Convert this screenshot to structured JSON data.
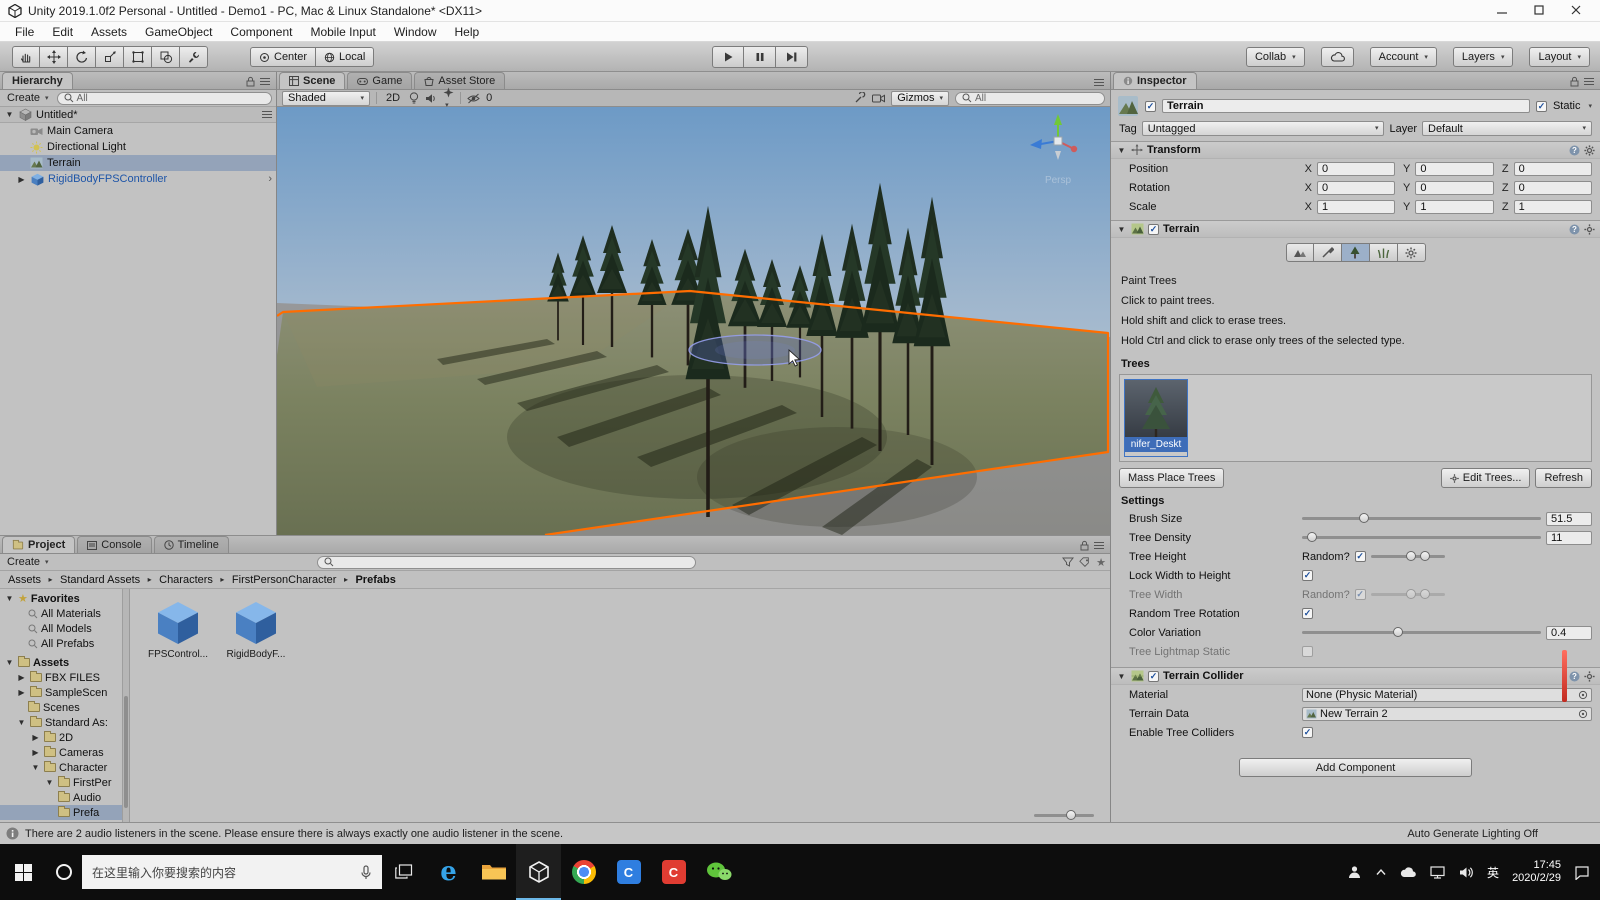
{
  "window": {
    "title": "Unity 2019.1.0f2 Personal - Untitled - Demo1 - PC, Mac & Linux Standalone* <DX11>"
  },
  "menu": {
    "items": [
      "File",
      "Edit",
      "Assets",
      "GameObject",
      "Component",
      "Mobile Input",
      "Window",
      "Help"
    ]
  },
  "toolbar": {
    "pivot_label": "Center",
    "space_label": "Local",
    "collab_label": "Collab",
    "account_label": "Account",
    "layers_label": "Layers",
    "layout_label": "Layout"
  },
  "hierarchy": {
    "tab_label": "Hierarchy",
    "create_label": "Create",
    "search_text": "All",
    "scene_row": "Untitled*",
    "items": [
      {
        "label": "Main Camera"
      },
      {
        "label": "Directional Light"
      },
      {
        "label": "Terrain"
      },
      {
        "label": "RigidBodyFPSController"
      }
    ]
  },
  "scene": {
    "tab_scene": "Scene",
    "tab_game": "Game",
    "tab_asset_store": "Asset Store",
    "shading_mode": "Shaded",
    "toggle_2d": "2D",
    "hidden_count": "0",
    "gizmos_label": "Gizmos",
    "search_text": "All",
    "gizmo_caption": "Persp"
  },
  "inspector": {
    "tab_label": "Inspector",
    "object_name": "Terrain",
    "static_label": "Static",
    "tag_label": "Tag",
    "tag_value": "Untagged",
    "layer_label": "Layer",
    "layer_value": "Default",
    "transform": {
      "title": "Transform",
      "axis_x": "X",
      "axis_y": "Y",
      "axis_z": "Z",
      "rows": [
        {
          "label": "Position",
          "x": "0",
          "y": "0",
          "z": "0"
        },
        {
          "label": "Rotation",
          "x": "0",
          "y": "0",
          "z": "0"
        },
        {
          "label": "Scale",
          "x": "1",
          "y": "1",
          "z": "1"
        }
      ]
    },
    "terrain": {
      "title": "Terrain",
      "paint_title": "Paint Trees",
      "help_1": "Click to paint trees.",
      "help_2": "Hold shift and click to erase trees.",
      "help_3": "Hold Ctrl and click to erase only trees of the selected type.",
      "trees_label": "Trees",
      "tree_thumb_label": "nifer_Deskt",
      "mass_place_label": "Mass Place Trees",
      "edit_trees_label": "Edit Trees...",
      "refresh_label": "Refresh",
      "settings_label": "Settings",
      "brush_size_label": "Brush Size",
      "brush_size_value": "51.5",
      "tree_density_label": "Tree Density",
      "tree_density_value": "11",
      "tree_height_label": "Tree Height",
      "random_label": "Random?",
      "lock_width_label": "Lock Width to Height",
      "tree_width_label": "Tree Width",
      "random_rotation_label": "Random Tree Rotation",
      "color_variation_label": "Color Variation",
      "color_variation_value": "0.4",
      "lightmap_label": "Tree Lightmap Static"
    },
    "collider": {
      "title": "Terrain Collider",
      "material_label": "Material",
      "material_value": "None (Physic Material)",
      "terrain_data_label": "Terrain Data",
      "terrain_data_value": "New Terrain 2",
      "tree_colliders_label": "Enable Tree Colliders"
    },
    "add_component_label": "Add Component"
  },
  "project": {
    "tab_project": "Project",
    "tab_console": "Console",
    "tab_timeline": "Timeline",
    "create_label": "Create",
    "breadcrumb": [
      "Assets",
      "Standard Assets",
      "Characters",
      "FirstPersonCharacter",
      "Prefabs"
    ],
    "folders": [
      {
        "label": "Favorites"
      },
      {
        "label": "All Materials"
      },
      {
        "label": "All Models"
      },
      {
        "label": "All Prefabs"
      },
      {
        "label": "Assets"
      },
      {
        "label": "FBX FILES"
      },
      {
        "label": "SampleScen"
      },
      {
        "label": "Scenes"
      },
      {
        "label": "Standard As:"
      },
      {
        "label": "2D"
      },
      {
        "label": "Cameras"
      },
      {
        "label": "Character"
      },
      {
        "label": "FirstPer"
      },
      {
        "label": "Audio"
      },
      {
        "label": "Prefa"
      }
    ],
    "files": [
      {
        "label": "FPSControl..."
      },
      {
        "label": "RigidBodyF..."
      }
    ]
  },
  "status_bar": {
    "message": "There are 2 audio listeners in the scene. Please ensure there is always exactly one audio listener in the scene.",
    "lighting_status": "Auto Generate Lighting Off"
  },
  "taskbar": {
    "search_placeholder": "在这里输入你要搜索的内容",
    "edge_glyph": "e",
    "app_c1": "C",
    "app_c2": "C",
    "ime_label": "英",
    "time": "17:45",
    "date": "2020/2/29"
  }
}
